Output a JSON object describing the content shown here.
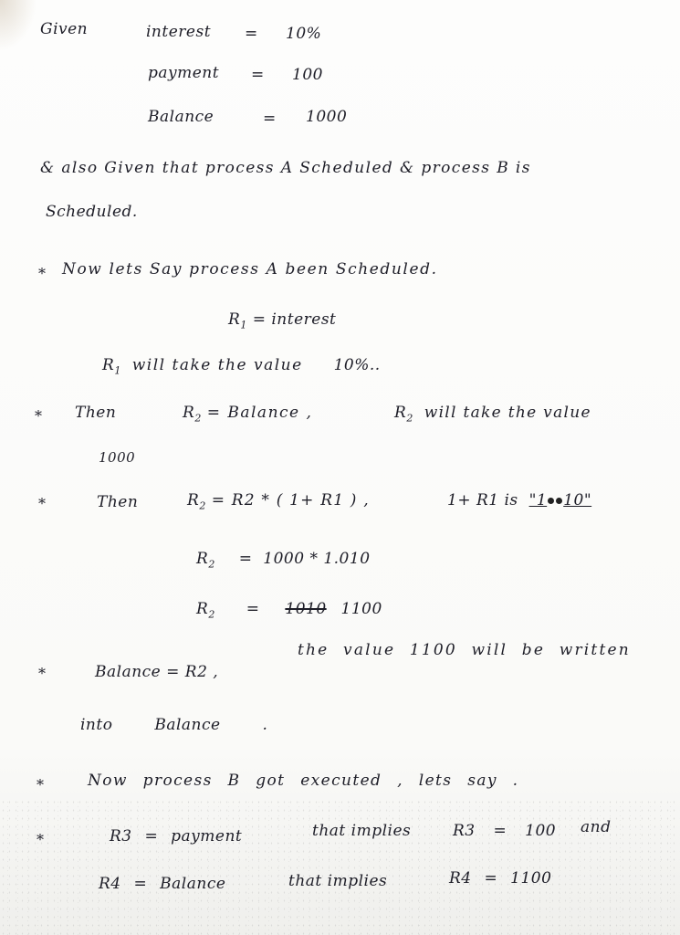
{
  "given": {
    "label": "Given",
    "items": [
      {
        "name": "interest",
        "eq": "=",
        "value": "10%"
      },
      {
        "name": "payment",
        "eq": "=",
        "value": "100"
      },
      {
        "name": "Balance",
        "eq": "=",
        "value": "1000"
      }
    ]
  },
  "intro": {
    "line1": "& also Given that process A Scheduled & process B is",
    "line2": "Scheduled."
  },
  "steps": {
    "star": "*",
    "s1": {
      "text": "Now lets Say process A been Scheduled.",
      "eq_left": "R",
      "eq_sub": "1",
      "eq_right": "= interest",
      "note_r": "R",
      "note_sub": "1",
      "note": "will take the value",
      "note_value": "10%.."
    },
    "s2": {
      "then": "Then",
      "lhs": "R",
      "lhs_sub": "2",
      "rhs": "= Balance ,",
      "note_r": "R",
      "note_sub": "2",
      "note": "will take the value",
      "value": "1000"
    },
    "s3": {
      "then": "Then",
      "formula_r": "R",
      "formula_sub": "2",
      "formula": "= R2 * ( 1+ R1 ) ,",
      "note": "1+ R1 is",
      "note_value_a": "\"1",
      "note_value_b": "10\"",
      "calc1_r": "R",
      "calc1_sub": "2",
      "calc1": "=  1000 * 1.010",
      "calc2_r": "R",
      "calc2_sub": "2",
      "calc2_eq": "=",
      "calc2_struck": "1010",
      "calc2_value": "1100"
    },
    "s4": {
      "lhs": "Balance = R2 ,",
      "text": "the value 1100 will be written",
      "text2": "into Balance ."
    },
    "s5": {
      "text": "Now process B got executed , lets say ."
    },
    "s6": {
      "r3": "R3 = payment",
      "implies": "that implies",
      "r3_value": "R3 = 100",
      "and": "and",
      "r4": "R4 = Balance",
      "implies2": "that implies",
      "r4_value": "R4 = 1100"
    }
  }
}
